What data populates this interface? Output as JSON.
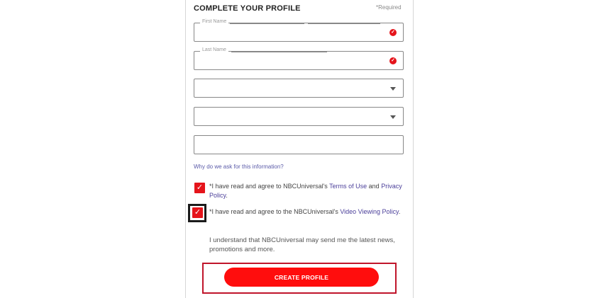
{
  "form": {
    "title": "COMPLETE YOUR PROFILE",
    "required_note": "*Required",
    "fields": [
      {
        "label": "First Name",
        "value": "",
        "state": "error"
      },
      {
        "label": "Last Name",
        "value": "",
        "state": "error"
      },
      {
        "label": "",
        "value": "",
        "type": "select"
      },
      {
        "label": "",
        "value": "",
        "type": "select"
      },
      {
        "label": "",
        "value": "",
        "type": "text"
      }
    ],
    "why_link": "Why do we ask for this information?",
    "consent1": {
      "prefix": "*I have read and agree to NBCUniversal's ",
      "link1": "Terms of Use",
      "middle": " and ",
      "link2": "Privacy Policy",
      "suffix": ".",
      "checked": true
    },
    "consent2": {
      "prefix": "*I have read and agree to the NBCUniversal's ",
      "link1": "Video Viewing Policy",
      "suffix": ".",
      "checked": true
    },
    "news_optin": "I understand that NBCUniversal may send me the latest news, promotions and more.",
    "submit_label": "CREATE PROFILE"
  },
  "icons": {
    "error": "alert-circle-icon",
    "dropdown": "chevron-down-icon",
    "check": "check-icon"
  },
  "colors": {
    "accent": "#ff0d0d",
    "link": "#4b3f9a",
    "highlight": "#c0152b"
  }
}
